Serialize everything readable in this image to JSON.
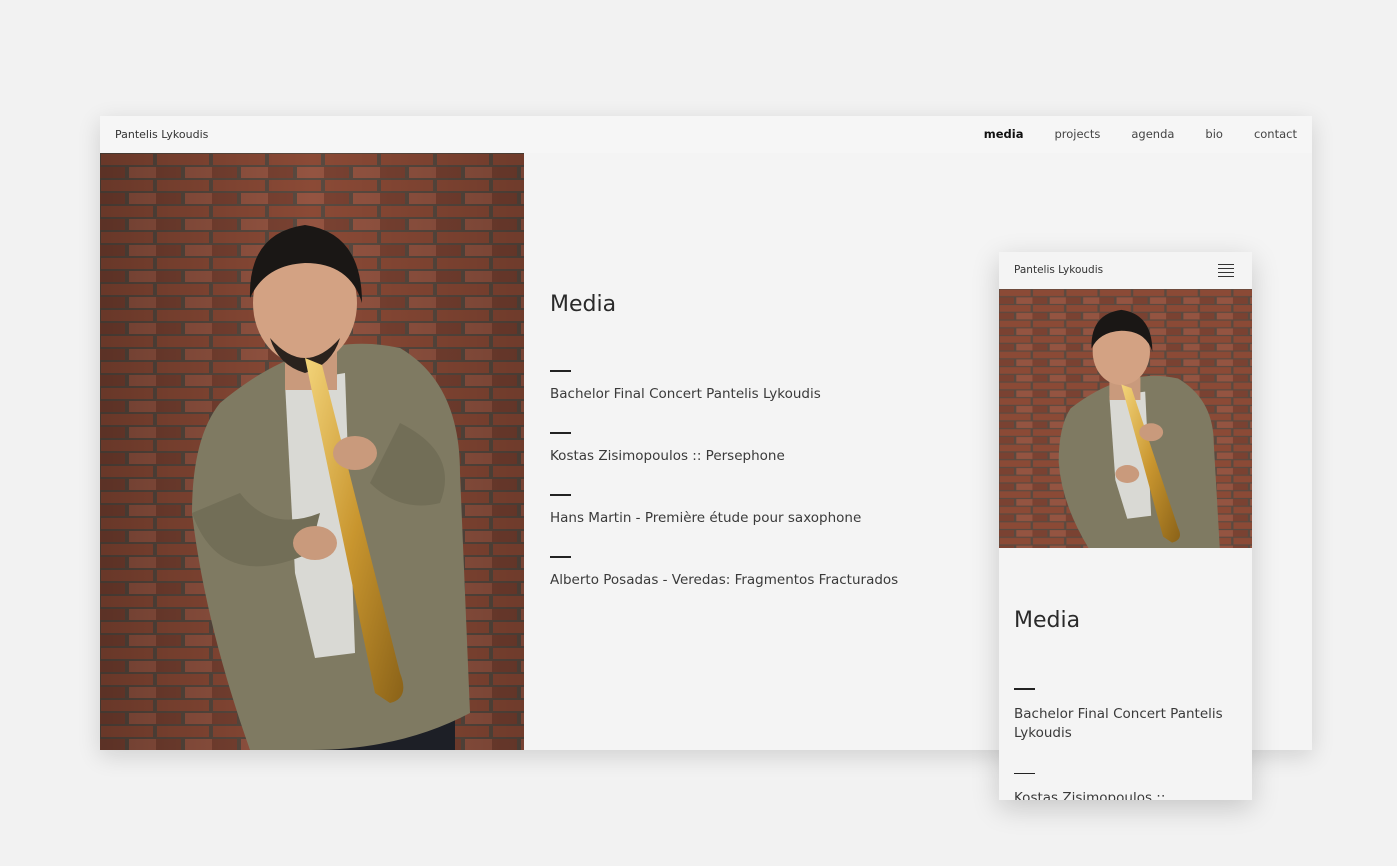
{
  "site": {
    "brand": "Pantelis Lykoudis"
  },
  "nav": [
    {
      "label": "media",
      "active": true
    },
    {
      "label": "projects",
      "active": false
    },
    {
      "label": "agenda",
      "active": false
    },
    {
      "label": "bio",
      "active": false
    },
    {
      "label": "contact",
      "active": false
    }
  ],
  "page": {
    "title": "Media",
    "items": [
      "Bachelor Final Concert Pantelis Lykoudis",
      "Kostas Zisimopoulos :: Persephone",
      "Hans Martin - Première étude pour saxophone",
      "Alberto Posadas - Veredas: Fragmentos Fracturados"
    ]
  },
  "photo": {
    "description_icon": "portrait-saxophone-photo"
  },
  "colors": {
    "background": "#f2f2f2",
    "text": "#2b2b2b",
    "brick": "#8a4a38",
    "jacket": "#7f7a62"
  },
  "mobile": {
    "menu_icon": "hamburger-icon"
  }
}
